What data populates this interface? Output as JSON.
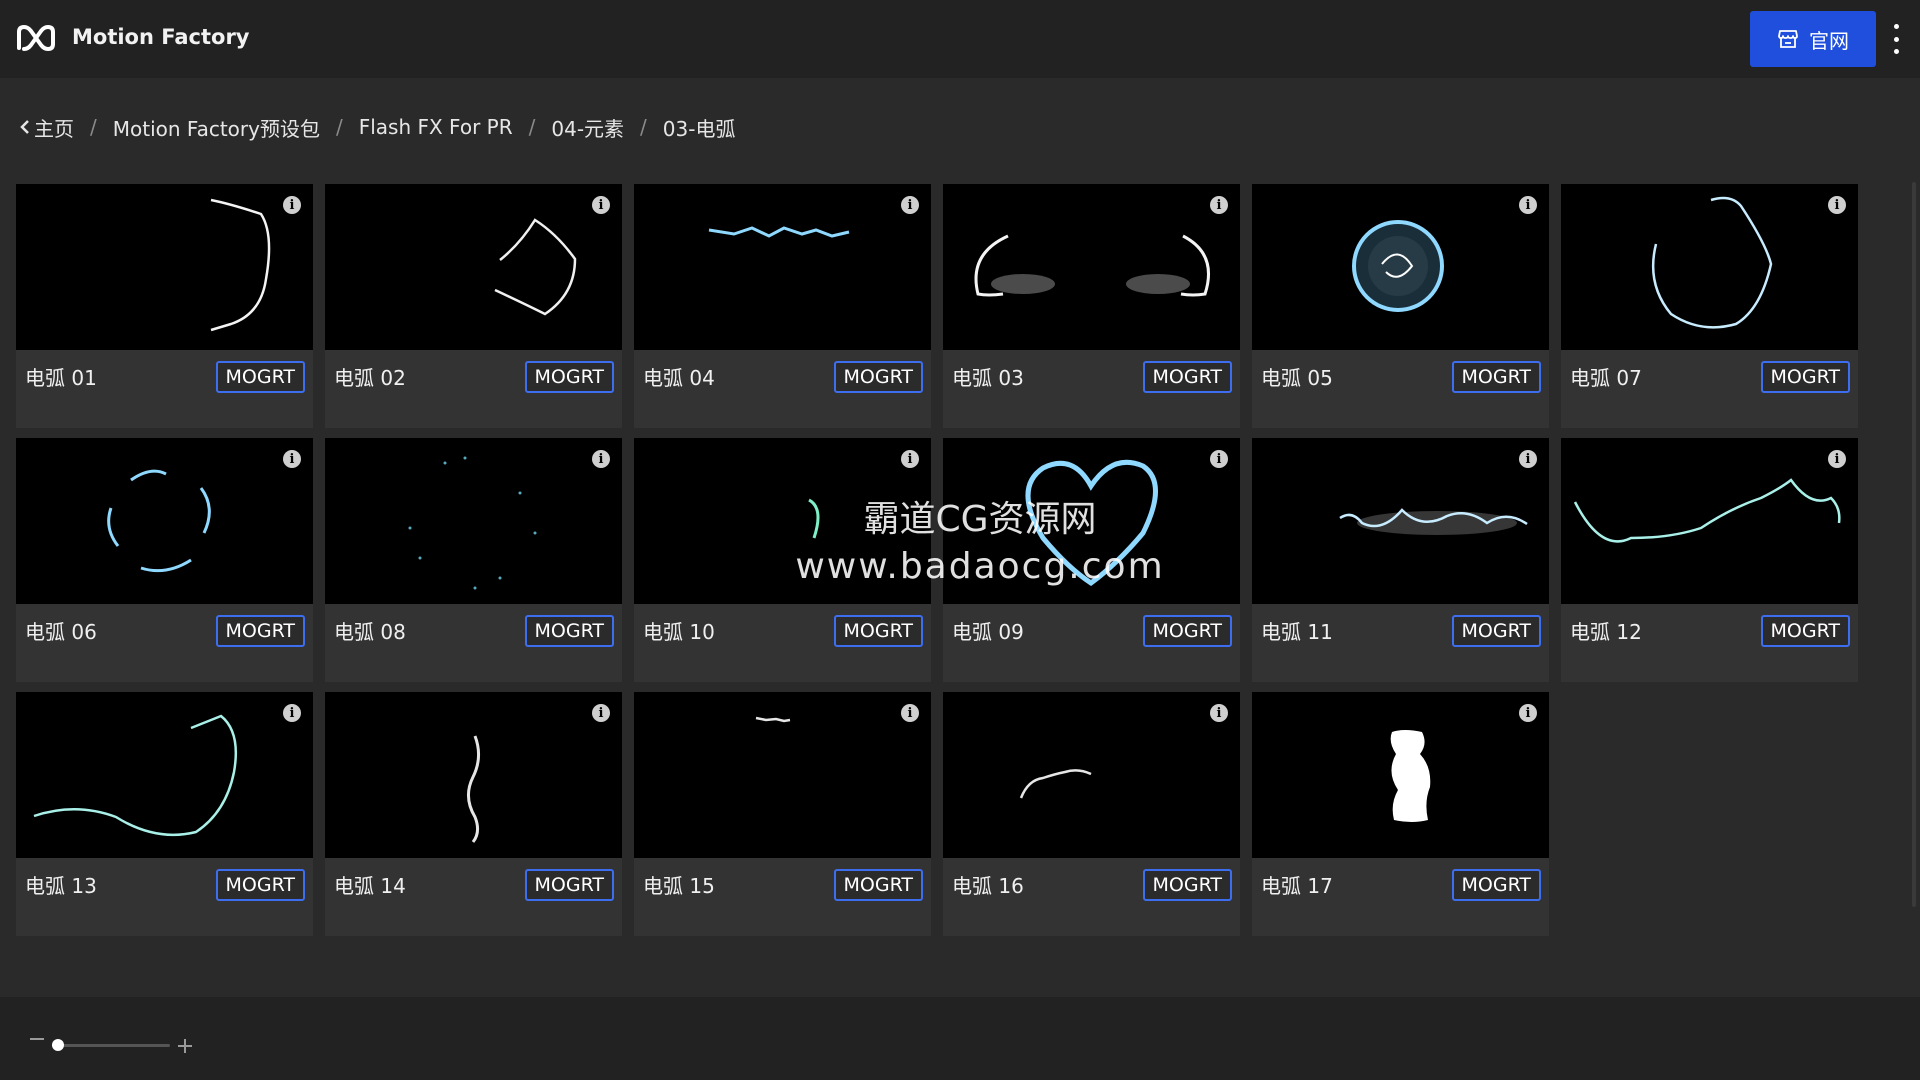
{
  "header": {
    "app_name": "Motion Factory",
    "site_button_label": "官网",
    "logo_icon": "motion-factory-logo-icon",
    "site_icon": "storefront-icon",
    "more_icon": "more-vertical-icon"
  },
  "breadcrumb": [
    {
      "label": "主页"
    },
    {
      "label": "Motion Factory预设包"
    },
    {
      "label": "Flash FX For PR"
    },
    {
      "label": "04-元素"
    },
    {
      "label": "03-电弧"
    }
  ],
  "items": [
    {
      "name": "电弧 01",
      "badge": "MOGRT"
    },
    {
      "name": "电弧 02",
      "badge": "MOGRT"
    },
    {
      "name": "电弧 04",
      "badge": "MOGRT"
    },
    {
      "name": "电弧 03",
      "badge": "MOGRT"
    },
    {
      "name": "电弧 05",
      "badge": "MOGRT"
    },
    {
      "name": "电弧 07",
      "badge": "MOGRT"
    },
    {
      "name": "电弧 06",
      "badge": "MOGRT"
    },
    {
      "name": "电弧 08",
      "badge": "MOGRT"
    },
    {
      "name": "电弧 10",
      "badge": "MOGRT"
    },
    {
      "name": "电弧 09",
      "badge": "MOGRT"
    },
    {
      "name": "电弧 11",
      "badge": "MOGRT"
    },
    {
      "name": "电弧 12",
      "badge": "MOGRT"
    },
    {
      "name": "电弧 13",
      "badge": "MOGRT"
    },
    {
      "name": "电弧 14",
      "badge": "MOGRT"
    },
    {
      "name": "电弧 15",
      "badge": "MOGRT"
    },
    {
      "name": "电弧 16",
      "badge": "MOGRT"
    },
    {
      "name": "电弧 17",
      "badge": "MOGRT"
    }
  ],
  "watermark": {
    "line1": "霸道CG资源网",
    "line2": "www.badaocg.com"
  },
  "zoom": {
    "level": 0.05
  },
  "colors": {
    "accent": "#1f4fdc",
    "badge_border": "#3d6ef0",
    "arc_blue": "#8fd8ff"
  }
}
